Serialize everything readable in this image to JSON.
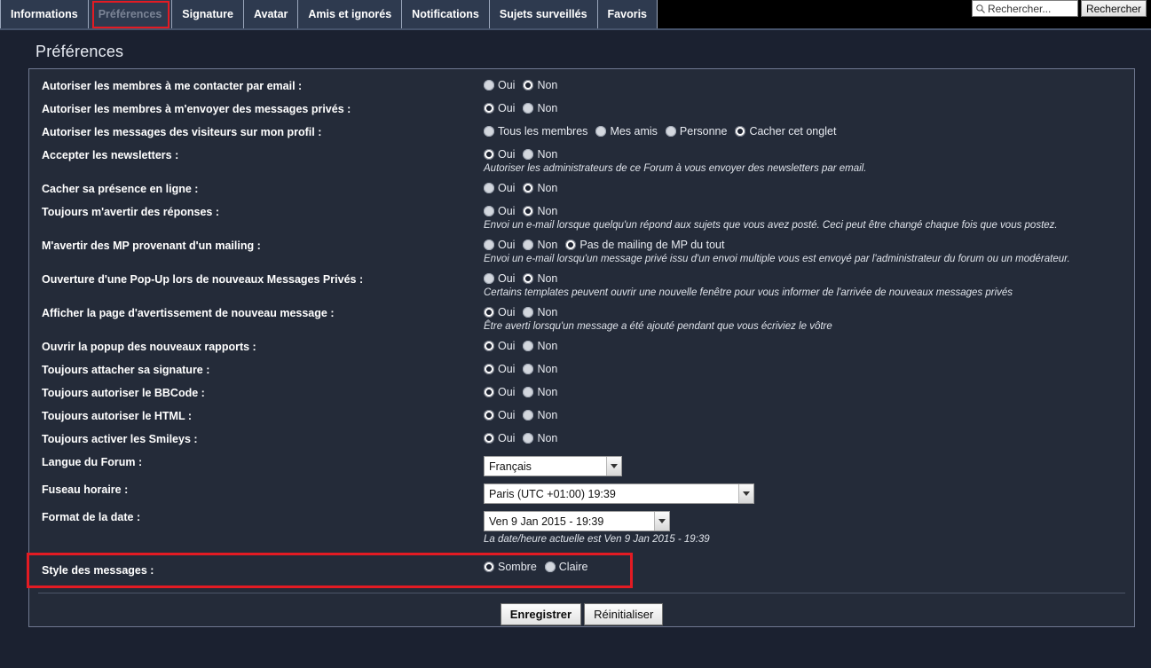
{
  "tabs": [
    {
      "label": "Informations",
      "active": false
    },
    {
      "label": "Préférences",
      "active": true
    },
    {
      "label": "Signature",
      "active": false
    },
    {
      "label": "Avatar",
      "active": false
    },
    {
      "label": "Amis et ignorés",
      "active": false
    },
    {
      "label": "Notifications",
      "active": false
    },
    {
      "label": "Sujets surveillés",
      "active": false
    },
    {
      "label": "Favoris",
      "active": false
    }
  ],
  "search": {
    "placeholder": "Rechercher...",
    "button_label": "Rechercher",
    "icon": "search-icon"
  },
  "page_title": "Préférences",
  "accent_color": "#e31b23",
  "rows": [
    {
      "label": "Autoriser les membres à me contacter par email :",
      "options": [
        {
          "label": "Oui",
          "selected": false
        },
        {
          "label": "Non",
          "selected": true
        }
      ],
      "hint": ""
    },
    {
      "label": "Autoriser les membres à m'envoyer des messages privés :",
      "options": [
        {
          "label": "Oui",
          "selected": true
        },
        {
          "label": "Non",
          "selected": false
        }
      ],
      "hint": ""
    },
    {
      "label": "Autoriser les messages des visiteurs sur mon profil :",
      "options": [
        {
          "label": "Tous les membres",
          "selected": false
        },
        {
          "label": "Mes amis",
          "selected": false
        },
        {
          "label": "Personne",
          "selected": false
        },
        {
          "label": "Cacher cet onglet",
          "selected": true
        }
      ],
      "hint": ""
    },
    {
      "label": "Accepter les newsletters :",
      "options": [
        {
          "label": "Oui",
          "selected": true
        },
        {
          "label": "Non",
          "selected": false
        }
      ],
      "hint": "Autoriser les administrateurs de ce Forum à vous envoyer des newsletters par email."
    },
    {
      "label": "Cacher sa présence en ligne :",
      "options": [
        {
          "label": "Oui",
          "selected": false
        },
        {
          "label": "Non",
          "selected": true
        }
      ],
      "hint": ""
    },
    {
      "label": "Toujours m'avertir des réponses :",
      "options": [
        {
          "label": "Oui",
          "selected": false
        },
        {
          "label": "Non",
          "selected": true
        }
      ],
      "hint": "Envoi un e-mail lorsque quelqu'un répond aux sujets que vous avez posté. Ceci peut être changé chaque fois que vous postez."
    },
    {
      "label": "M'avertir des MP provenant d'un mailing :",
      "options": [
        {
          "label": "Oui",
          "selected": false
        },
        {
          "label": "Non",
          "selected": false
        },
        {
          "label": "Pas de mailing de MP du tout",
          "selected": true
        }
      ],
      "hint": "Envoi un e-mail lorsqu'un message privé issu d'un envoi multiple vous est envoyé par l'administrateur du forum ou un modérateur."
    },
    {
      "label": "Ouverture d'une Pop-Up lors de nouveaux Messages Privés :",
      "options": [
        {
          "label": "Oui",
          "selected": false
        },
        {
          "label": "Non",
          "selected": true
        }
      ],
      "hint": "Certains templates peuvent ouvrir une nouvelle fenêtre pour vous informer de l'arrivée de nouveaux messages privés"
    },
    {
      "label": "Afficher la page d'avertissement de nouveau message :",
      "options": [
        {
          "label": "Oui",
          "selected": true
        },
        {
          "label": "Non",
          "selected": false
        }
      ],
      "hint": "Être averti lorsqu'un message a été ajouté pendant que vous écriviez le vôtre"
    },
    {
      "label": "Ouvrir la popup des nouveaux rapports :",
      "options": [
        {
          "label": "Oui",
          "selected": true
        },
        {
          "label": "Non",
          "selected": false
        }
      ],
      "hint": ""
    },
    {
      "label": "Toujours attacher sa signature :",
      "options": [
        {
          "label": "Oui",
          "selected": true
        },
        {
          "label": "Non",
          "selected": false
        }
      ],
      "hint": ""
    },
    {
      "label": "Toujours autoriser le BBCode :",
      "options": [
        {
          "label": "Oui",
          "selected": true
        },
        {
          "label": "Non",
          "selected": false
        }
      ],
      "hint": ""
    },
    {
      "label": "Toujours autoriser le HTML :",
      "options": [
        {
          "label": "Oui",
          "selected": true
        },
        {
          "label": "Non",
          "selected": false
        }
      ],
      "hint": ""
    },
    {
      "label": "Toujours activer les Smileys :",
      "options": [
        {
          "label": "Oui",
          "selected": true
        },
        {
          "label": "Non",
          "selected": false
        }
      ],
      "hint": ""
    }
  ],
  "selects": [
    {
      "label": "Langue du Forum :",
      "value": "Français",
      "width_class": "w-lang",
      "hint": ""
    },
    {
      "label": "Fuseau horaire :",
      "value": "Paris (UTC +01:00) 19:39",
      "width_class": "w-tz",
      "hint": ""
    },
    {
      "label": "Format de la date :",
      "value": "Ven 9 Jan 2015 - 19:39",
      "width_class": "w-date",
      "hint": "La date/heure actuelle est Ven 9 Jan 2015 - 19:39"
    }
  ],
  "style_row": {
    "label": "Style des messages :",
    "options": [
      {
        "label": "Sombre",
        "selected": true
      },
      {
        "label": "Claire",
        "selected": false
      }
    ]
  },
  "buttons": {
    "submit_label": "Enregistrer",
    "reset_label": "Réinitialiser"
  }
}
